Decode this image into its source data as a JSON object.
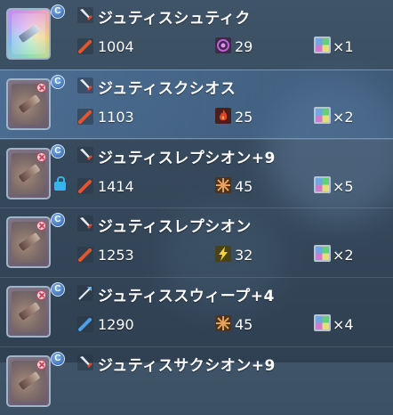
{
  "items": [
    {
      "name": "ジュティスシュティク",
      "attack": "1004",
      "potential_icon": "purple-target-icon",
      "potential_color": "#c25fd6",
      "potential_value": "29",
      "grind": "×1",
      "rainbow": true,
      "no_badge": false,
      "locked": false
    },
    {
      "name": "ジュティスクシオス",
      "attack": "1103",
      "potential_icon": "fire-icon",
      "potential_color": "#e0452c",
      "potential_value": "25",
      "grind": "×2",
      "rainbow": false,
      "no_badge": true,
      "locked": false,
      "selected": true
    },
    {
      "name": "ジュティスレプシオン+9",
      "attack": "1414",
      "potential_icon": "cross-burst-icon",
      "potential_color": "#e6a15a",
      "potential_value": "45",
      "grind": "×5",
      "rainbow": false,
      "no_badge": true,
      "locked": true
    },
    {
      "name": "ジュティスレプシオン",
      "attack": "1253",
      "potential_icon": "lightning-icon",
      "potential_color": "#f0d43a",
      "potential_value": "32",
      "grind": "×2",
      "rainbow": false,
      "no_badge": true,
      "locked": false
    },
    {
      "name": "ジュティススウィープ+4",
      "attack": "1290",
      "potential_icon": "cross-burst-icon",
      "potential_color": "#e6a15a",
      "potential_value": "45",
      "grind": "×4",
      "rainbow": false,
      "no_badge": true,
      "locked": false
    },
    {
      "name": "ジュティスサクシオン+9",
      "rainbow": false,
      "no_badge": true,
      "locked": false
    }
  ],
  "class_badge": "C"
}
